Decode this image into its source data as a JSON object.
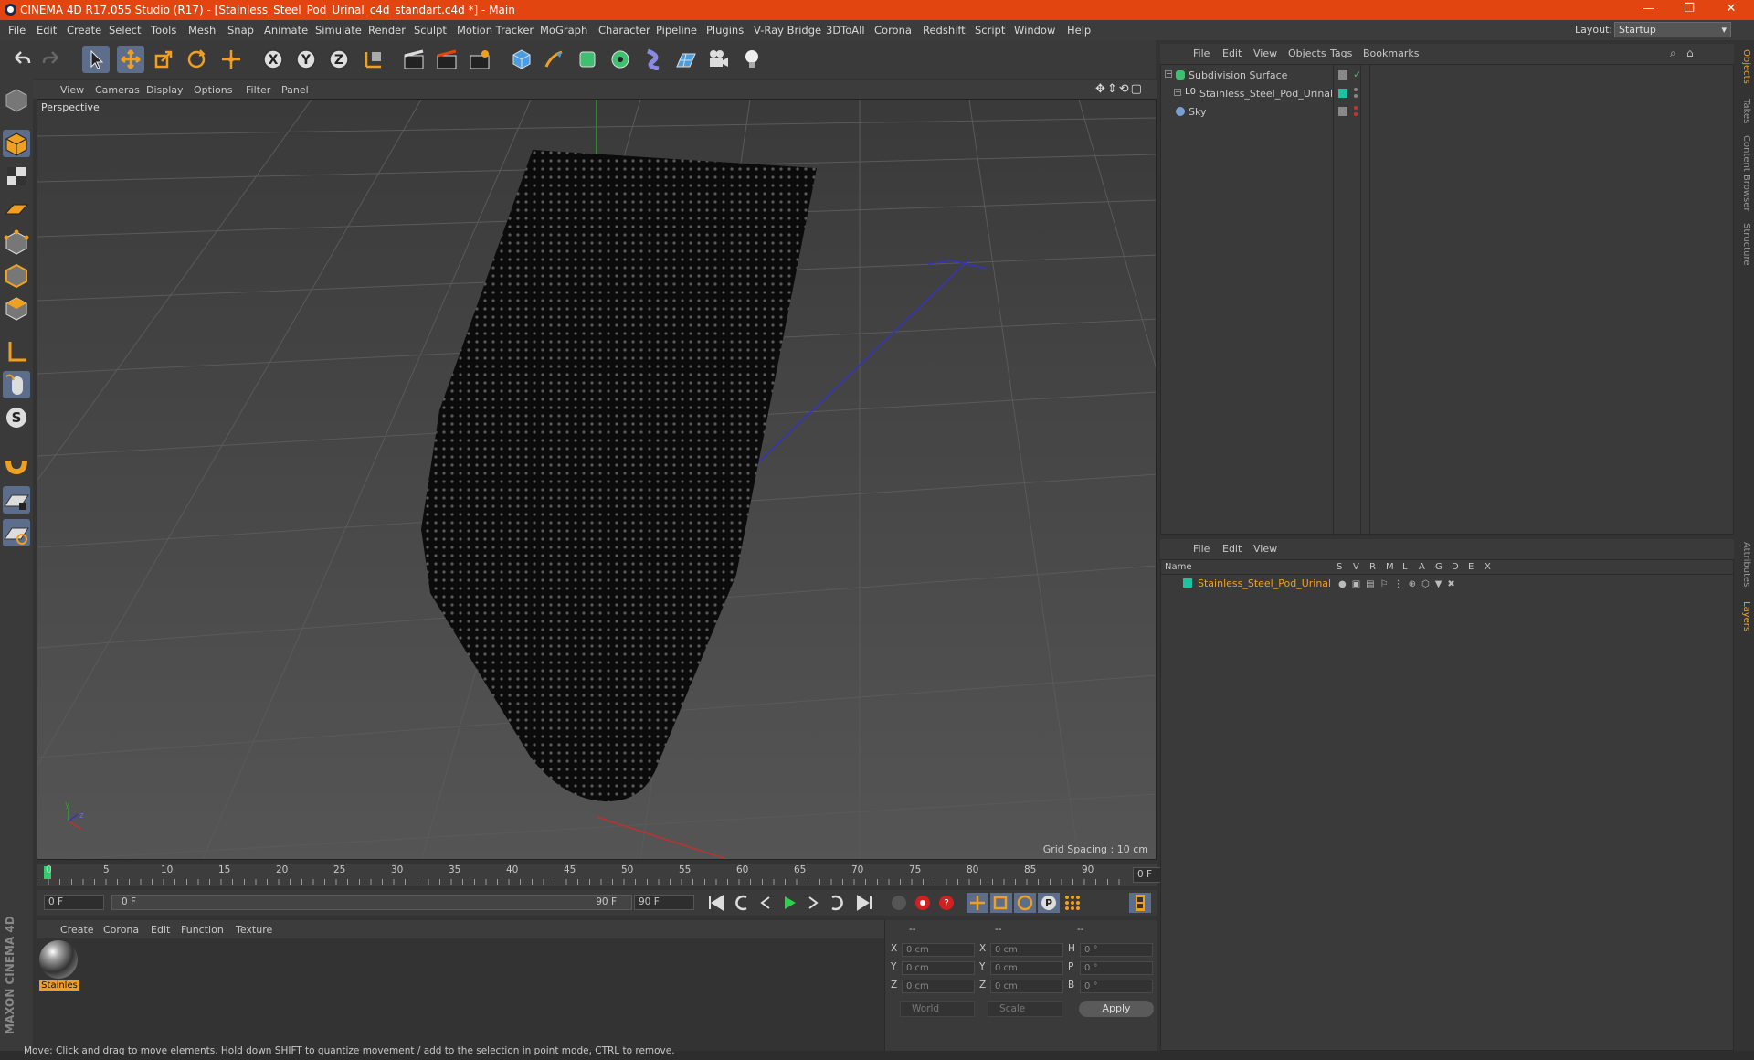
{
  "window": {
    "title": "CINEMA 4D R17.055 Studio (R17) - [Stainless_Steel_Pod_Urinal_c4d_standart.c4d *] - Main",
    "minimize": "—",
    "maximize": "❐",
    "close": "✕"
  },
  "menubar": {
    "items": [
      "File",
      "Edit",
      "Create",
      "Select",
      "Tools",
      "Mesh",
      "Snap",
      "Animate",
      "Simulate",
      "Render",
      "Sculpt",
      "Motion Tracker",
      "MoGraph",
      "Character",
      "Pipeline",
      "Plugins",
      "V-Ray Bridge",
      "3DToAll",
      "Corona",
      "Redshift",
      "Script",
      "Window",
      "Help"
    ],
    "layout_label": "Layout:",
    "layout_value": "Startup"
  },
  "viewport": {
    "menu": [
      "View",
      "Cameras",
      "Display",
      "Options",
      "Filter",
      "Panel"
    ],
    "label": "Perspective",
    "grid_spacing": "Grid Spacing : 10 cm"
  },
  "timeline": {
    "ticks": [
      "0",
      "5",
      "10",
      "15",
      "20",
      "25",
      "30",
      "35",
      "40",
      "45",
      "50",
      "55",
      "60",
      "65",
      "70",
      "75",
      "80",
      "85",
      "90"
    ],
    "current_frame": "0 F",
    "start_field": "0 F",
    "range_start": "0 F",
    "range_end": "90 F",
    "end_field": "90 F"
  },
  "material_manager": {
    "menu": [
      "Create",
      "Corona",
      "Edit",
      "Function",
      "Texture"
    ],
    "material_label": "Stainles"
  },
  "coordinates": {
    "header": [
      "--",
      "--",
      "--"
    ],
    "rows": [
      {
        "a": "X",
        "av": "0 cm",
        "b": "X",
        "bv": "0 cm",
        "c": "H",
        "cv": "0 °"
      },
      {
        "a": "Y",
        "av": "0 cm",
        "b": "Y",
        "bv": "0 cm",
        "c": "P",
        "cv": "0 °"
      },
      {
        "a": "Z",
        "av": "0 cm",
        "b": "Z",
        "bv": "0 cm",
        "c": "B",
        "cv": "0 °"
      }
    ],
    "space": "World",
    "mode": "Scale",
    "apply": "Apply"
  },
  "object_manager": {
    "menu": [
      "File",
      "Edit",
      "View",
      "Objects",
      "Tags",
      "Bookmarks"
    ],
    "objects": [
      {
        "name": "Subdivision Surface"
      },
      {
        "name": "Stainless_Steel_Pod_Urinal"
      },
      {
        "name": "Sky"
      }
    ]
  },
  "layer_manager": {
    "menu": [
      "File",
      "Edit",
      "View"
    ],
    "columns": [
      "Name",
      "S",
      "V",
      "R",
      "M",
      "L",
      "A",
      "G",
      "D",
      "E",
      "X"
    ],
    "layer_name": "Stainless_Steel_Pod_Urinal"
  },
  "right_tabs": [
    "Objects",
    "Takes",
    "Content Browser",
    "Structure",
    "Attributes",
    "Layers"
  ],
  "status": "Move: Click and drag to move elements. Hold down SHIFT to quantize movement / add to the selection in point mode, CTRL to remove.",
  "branding": "MAXON CINEMA 4D",
  "colors": {
    "titlebar": "#e2450f",
    "accent_orange": "#f0a020",
    "selected_tool": "#5c6e8c",
    "layer_color": "#20c0a0"
  }
}
